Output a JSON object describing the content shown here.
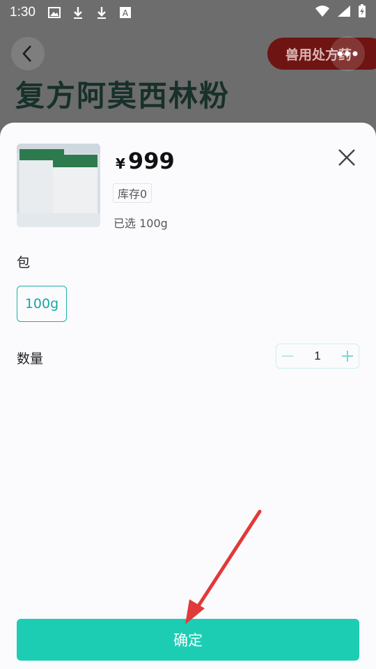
{
  "status_bar": {
    "time": "1:30"
  },
  "background": {
    "tag_text": "兽用处方药",
    "hero_title": "复方阿莫西林粉"
  },
  "sheet": {
    "price_symbol": "¥",
    "price": "999",
    "stock": "库存0",
    "selected": "已选 100g",
    "spec_label": "包",
    "spec_option": "100g",
    "quantity_label": "数量",
    "quantity_value": "1",
    "confirm_label": "确定"
  },
  "colors": {
    "accent": "#1ccdb4",
    "option_border": "#1ab0aa",
    "annotation_arrow": "#e03a3a"
  }
}
